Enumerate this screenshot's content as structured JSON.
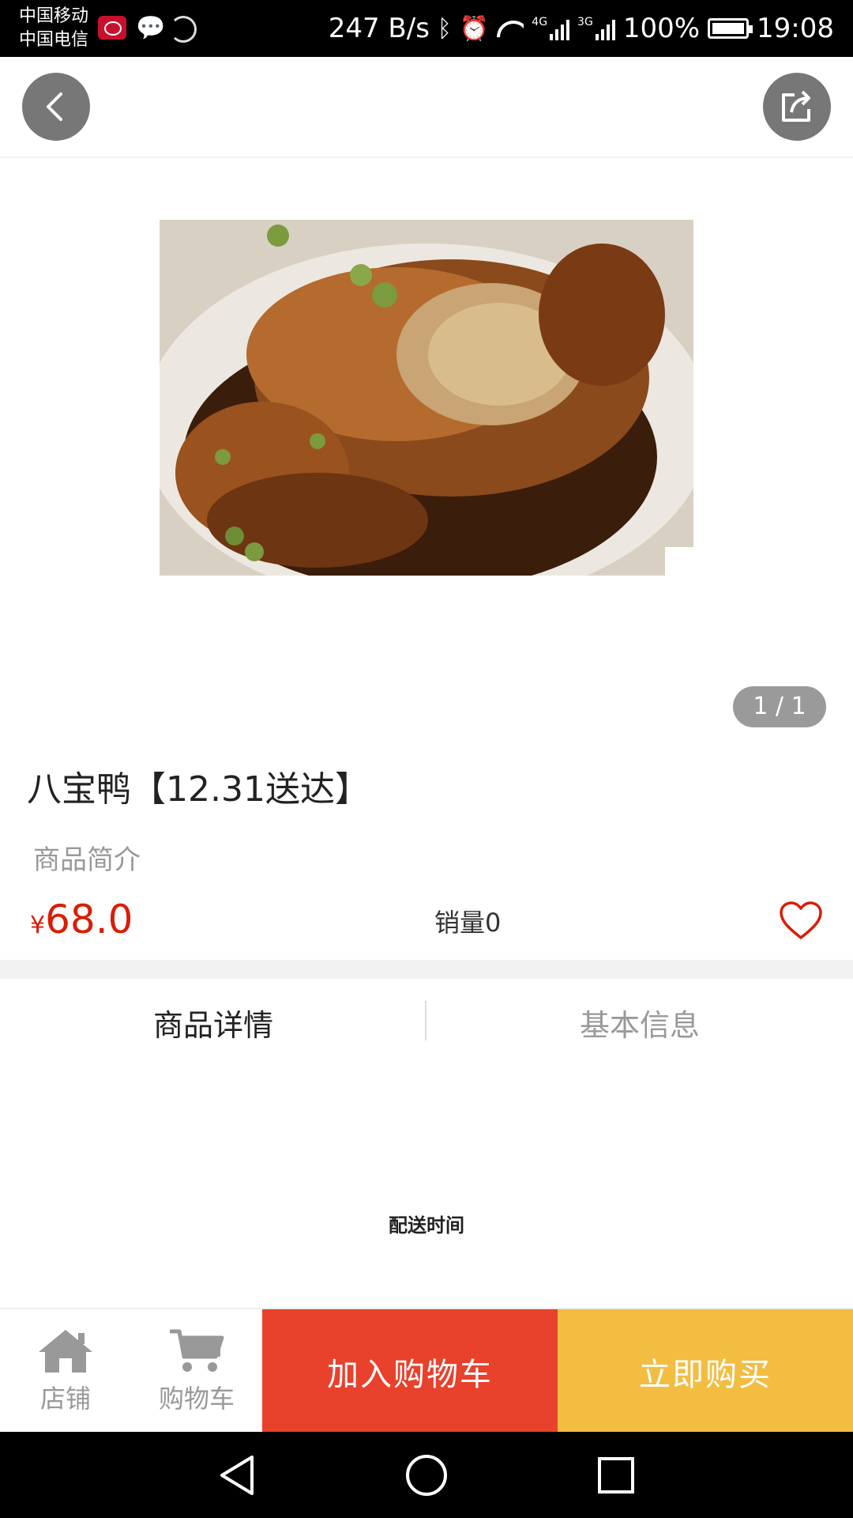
{
  "status_bar": {
    "carrier_1": "中国移动",
    "carrier_2": "中国电信",
    "net_speed": "247 B/s",
    "sig1_label": "4G",
    "sig2_label": "3G",
    "battery": "100%",
    "time": "19:08"
  },
  "gallery": {
    "pager": "1 / 1"
  },
  "product": {
    "title": "八宝鸭【12.31送达】",
    "intro": "商品简介",
    "currency": "¥",
    "price": "68.0",
    "sales": "销量0"
  },
  "tabs": [
    {
      "label": "商品详情",
      "active": true
    },
    {
      "label": "基本信息",
      "active": false
    }
  ],
  "detail": {
    "text": "配送时间"
  },
  "bottom_bar": {
    "shop": "店铺",
    "cart": "购物车",
    "add_to_cart": "加入购物车",
    "buy_now": "立即购买"
  },
  "colors": {
    "price": "#d81e06",
    "add_to_cart_bg": "#e8412c",
    "buy_now_bg": "#f3bd42",
    "button_circle": "#777777"
  },
  "icons": {
    "back": "chevron-left-icon",
    "share": "share-icon",
    "favorite": "heart-outline-icon",
    "shop": "home-icon",
    "cart": "cart-icon"
  }
}
